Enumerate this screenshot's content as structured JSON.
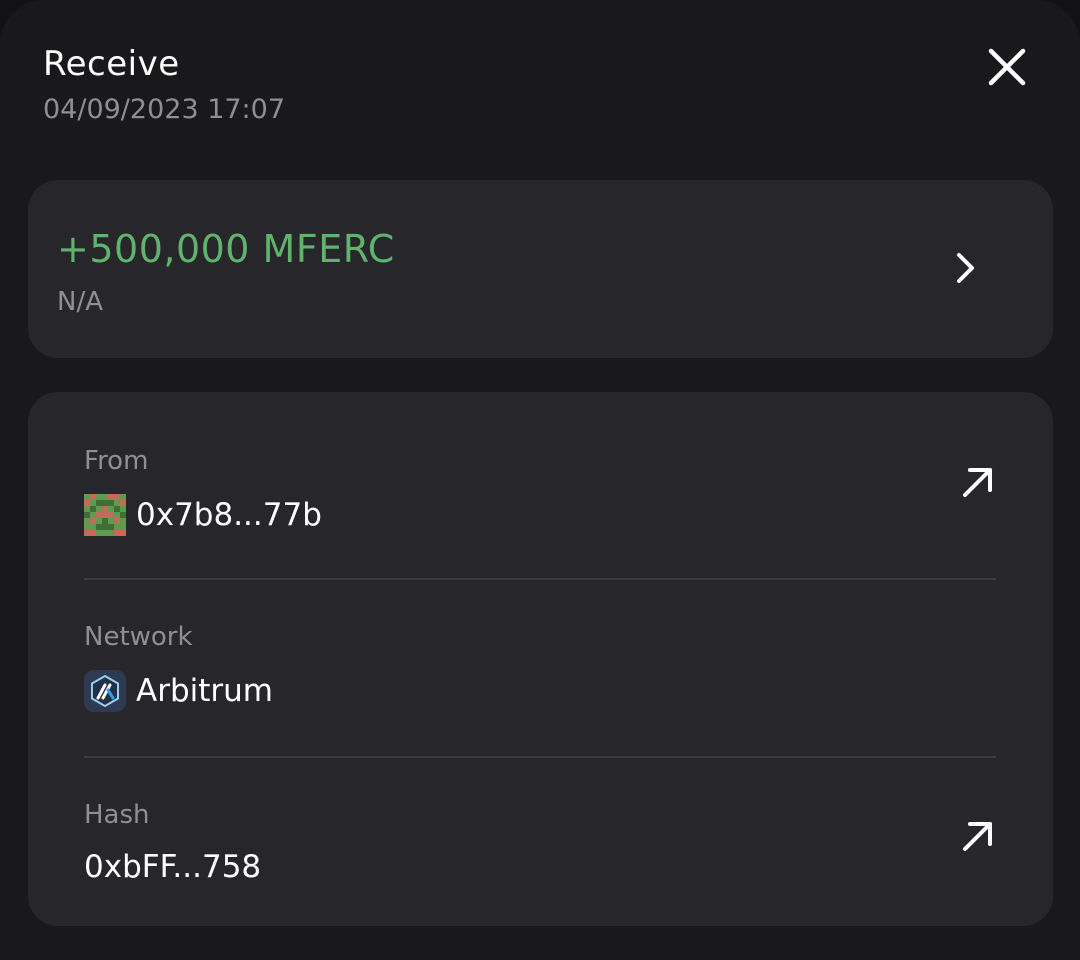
{
  "header": {
    "title": "Receive",
    "datetime": "04/09/2023 17:07"
  },
  "icons": {
    "close": "close-icon",
    "chevron": "chevron-right-icon",
    "external": "arrow-up-right-icon",
    "avatar": "pixel-avatar-icon",
    "network": "arbitrum-logo-icon"
  },
  "amount": {
    "value": "+500,000 MFERC",
    "fiat": "N/A"
  },
  "details": {
    "from": {
      "label": "From",
      "value": "0x7b8...77b"
    },
    "network": {
      "label": "Network",
      "value": "Arbitrum"
    },
    "hash": {
      "label": "Hash",
      "value": "0xbFF...758"
    }
  },
  "colors": {
    "background": "#19191c",
    "card": "#27272b",
    "positive_amount": "#5fb36d",
    "secondary_text": "#8e8e93"
  }
}
